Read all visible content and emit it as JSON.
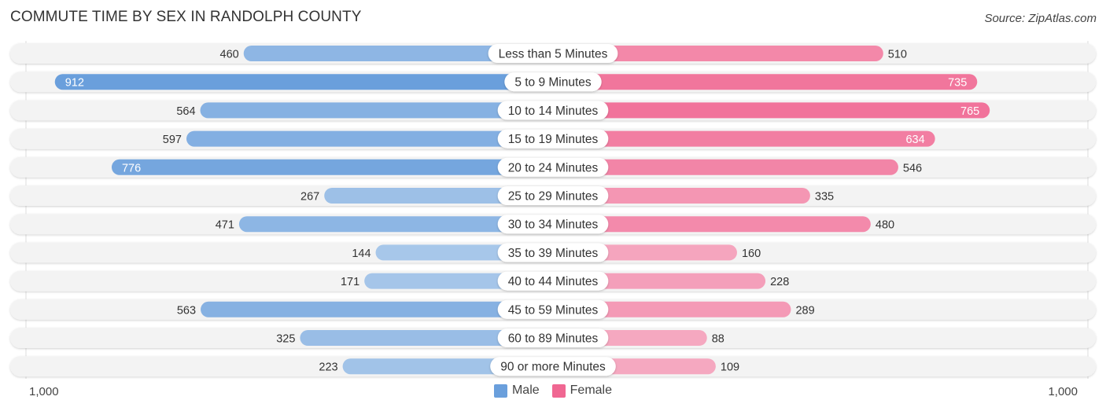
{
  "header": {
    "title": "COMMUTE TIME BY SEX IN RANDOLPH COUNTY",
    "source": "Source: ZipAtlas.com"
  },
  "colors": {
    "male": "#6a9fdc",
    "male_light": "#a9c8ea",
    "female": "#f06792",
    "female_light": "#f5a8c0",
    "row_bg": "#f3f3f3",
    "pill_bg": "#ffffff"
  },
  "axis": {
    "left_label": "1,000",
    "right_label": "1,000"
  },
  "legend": {
    "male_label": "Male",
    "female_label": "Female"
  },
  "chart_data": {
    "type": "bar",
    "orientation": "horizontal-diverging",
    "title": "COMMUTE TIME BY SEX IN RANDOLPH COUNTY",
    "xlabel": "",
    "ylabel": "",
    "xlim": [
      -1000,
      1000
    ],
    "legend_position": "bottom-center",
    "categories": [
      "Less than 5 Minutes",
      "5 to 9 Minutes",
      "10 to 14 Minutes",
      "15 to 19 Minutes",
      "20 to 24 Minutes",
      "25 to 29 Minutes",
      "30 to 34 Minutes",
      "35 to 39 Minutes",
      "40 to 44 Minutes",
      "45 to 59 Minutes",
      "60 to 89 Minutes",
      "90 or more Minutes"
    ],
    "series": [
      {
        "name": "Male",
        "values": [
          460,
          912,
          564,
          597,
          776,
          267,
          471,
          144,
          171,
          563,
          325,
          223
        ]
      },
      {
        "name": "Female",
        "values": [
          510,
          735,
          765,
          634,
          546,
          335,
          480,
          160,
          228,
          289,
          88,
          109
        ]
      }
    ]
  }
}
